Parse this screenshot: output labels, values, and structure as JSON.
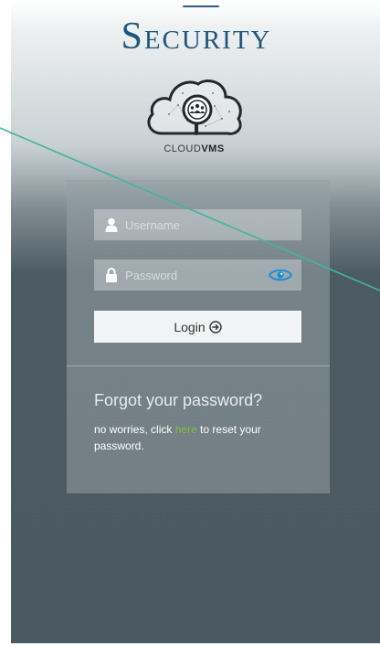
{
  "brand": {
    "title": "Security"
  },
  "cloud_logo": {
    "caption_light": "CLOUD",
    "caption_bold": "VMS"
  },
  "login": {
    "username_placeholder": "Username",
    "password_placeholder": "Password",
    "login_label": "Login",
    "login_icon": "arrow-circle-right-icon"
  },
  "forgot": {
    "title": "Forgot your password?",
    "text_before": "no worries, click ",
    "link_text": "here",
    "text_after": " to reset your password."
  },
  "colors": {
    "brand_blue": "#1e567b",
    "link_green": "#7ec13b",
    "eye_blue": "#1a8fd4",
    "accent_line": "#3fb6a0"
  }
}
